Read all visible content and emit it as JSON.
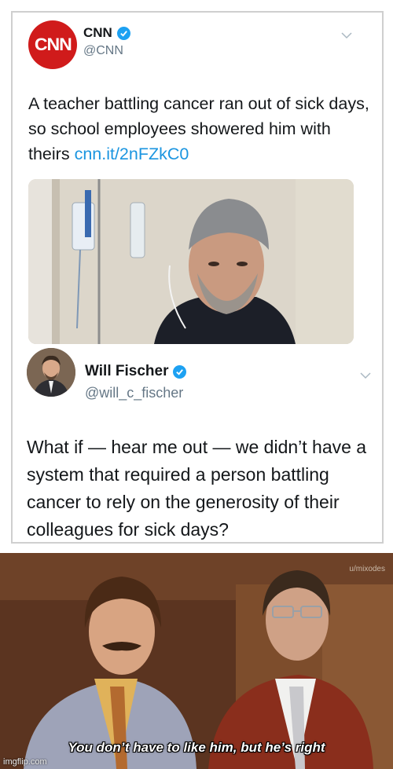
{
  "tweet1": {
    "name": "CNN",
    "handle": "@CNN",
    "text": "A teacher battling cancer ran out of sick days, so school employees showered him with theirs",
    "link": "cnn.it/2nFZkC0",
    "avatar_logo": "CNN"
  },
  "tweet2": {
    "name": "Will Fischer",
    "handle": "@will_c_fischer",
    "text": "What if — hear me out — we didn’t have a system that required a person battling cancer to rely on the generosity of their colleagues for sick days?"
  },
  "meme": {
    "caption": "You don’t have to like him, but he’s right",
    "watermark_top": "u/mixodes",
    "watermark_bottom": "imgflip.com"
  },
  "colors": {
    "verified": "#1da1f2",
    "link": "#1b95e0",
    "cnn_red": "#d01b1b"
  }
}
